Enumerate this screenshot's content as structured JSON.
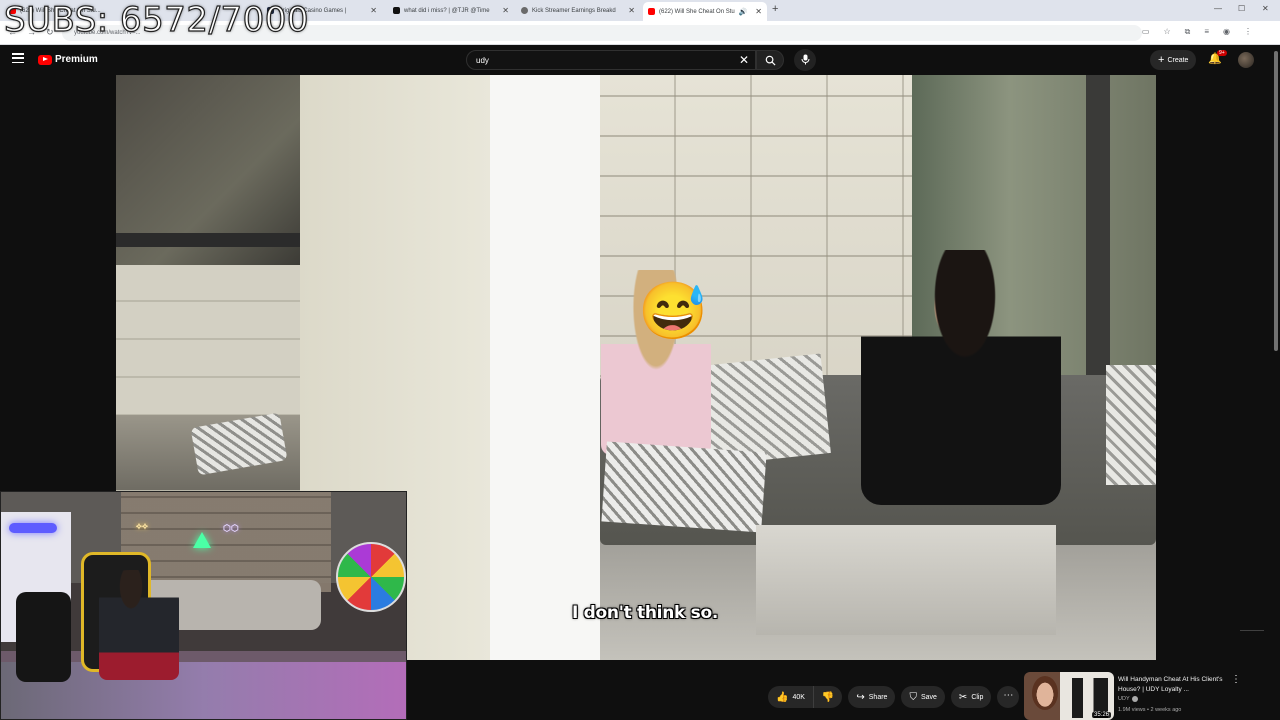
{
  "overlay": {
    "subs_counter": "SUBS: 6572/7000"
  },
  "browser": {
    "tabs": [
      {
        "label": "(622) Will She Cheat On Stu...",
        "favicon_color": "#ff0000",
        "active": false
      },
      {
        "label": "Originals Casino Games |",
        "favicon_color": "#1f2a44",
        "active": false
      },
      {
        "label": "what did i miss? | @TJR @Time",
        "favicon_color": "#111111",
        "active": false
      },
      {
        "label": "Kick Streamer Earnings Breakd",
        "favicon_color": "#6a6a6a",
        "active": false
      },
      {
        "label": "(622) Will She Cheat On Stu",
        "favicon_color": "#ff0000",
        "active": true
      }
    ],
    "new_tab": "+",
    "address": "youtube.com/watch?v=..."
  },
  "youtube": {
    "logo_text": "Premium",
    "search_value": "udy",
    "create_label": "Create",
    "notif_badge": "9+"
  },
  "video": {
    "subtitle": "I don't think so."
  },
  "actions": {
    "like_count": "40K",
    "share_label": "Share",
    "save_label": "Save",
    "clip_label": "Clip"
  },
  "recommendation": {
    "title": "Will Handyman Cheat At His Client's House? | UDY Loyalty ...",
    "channel": "UDY",
    "meta": "1.9M views • 2 weeks ago",
    "duration": "35:26"
  },
  "colors": {
    "youtube_red": "#ff0000",
    "dark_bg": "#0f0f0f",
    "pill_bg": "#272727"
  }
}
